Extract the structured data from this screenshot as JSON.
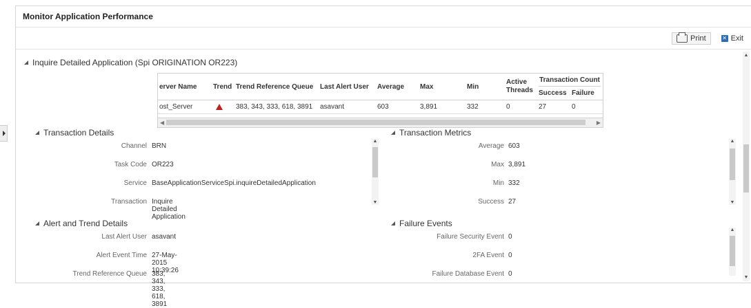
{
  "page": {
    "title": "Monitor Application Performance"
  },
  "toolbar": {
    "print_label": "Print",
    "exit_label": "Exit"
  },
  "app_section": {
    "title": "Inquire Detailed Application (Spi ORIGINATION OR223)"
  },
  "grid": {
    "headers": {
      "server_name": "erver Name",
      "trend": "Trend",
      "trend_ref_queue": "Trend Reference Queue",
      "last_alert_user": "Last Alert User",
      "average": "Average",
      "max": "Max",
      "min": "Min",
      "active_threads": "Active Threads",
      "transaction_count": "Transaction Count",
      "success": "Success",
      "failure": "Failure"
    },
    "row": {
      "server_name": "ost_Server",
      "trend_icon": "trend-up-icon",
      "trend_ref_queue": "383, 343, 333, 618, 3891",
      "last_alert_user": "asavant",
      "average": "603",
      "max": "3,891",
      "min": "332",
      "active_threads": "0",
      "success": "27",
      "failure": "0"
    }
  },
  "transaction_details": {
    "title": "Transaction Details",
    "fields": [
      {
        "label": "Channel",
        "value": "BRN"
      },
      {
        "label": "Task Code",
        "value": "OR223"
      },
      {
        "label": "Service",
        "value": "BaseApplicationServiceSpi.inquireDetailedApplication"
      },
      {
        "label": "Transaction",
        "value": "Inquire Detailed Application"
      }
    ]
  },
  "transaction_metrics": {
    "title": "Transaction Metrics",
    "fields": [
      {
        "label": "Average",
        "value": "603"
      },
      {
        "label": "Max",
        "value": "3,891"
      },
      {
        "label": "Min",
        "value": "332"
      },
      {
        "label": "Success",
        "value": "27"
      }
    ]
  },
  "alert_trend": {
    "title": "Alert and Trend Details",
    "fields": [
      {
        "label": "Last Alert User",
        "value": "asavant"
      },
      {
        "label": "Alert Event Time",
        "value": "27-May-2015 10:39:26"
      },
      {
        "label": "Trend Reference Queue",
        "value": "383, 343, 333, 618, 3891"
      }
    ]
  },
  "failure_events": {
    "title": "Failure Events",
    "fields": [
      {
        "label": "Failure Security Event",
        "value": "0"
      },
      {
        "label": "2FA Event",
        "value": "0"
      },
      {
        "label": "Failure Database Event",
        "value": "0"
      }
    ]
  },
  "colors": {
    "trend_icon": "#c0201c",
    "exit_icon": "#2f6eb5"
  }
}
